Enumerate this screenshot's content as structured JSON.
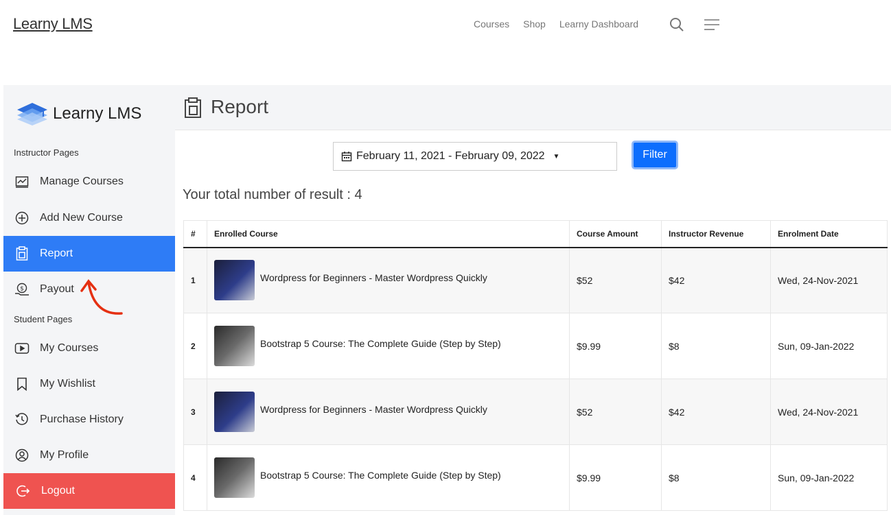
{
  "site": {
    "logo": "Learny LMS",
    "nav": [
      "Courses",
      "Shop",
      "Learny Dashboard"
    ]
  },
  "sidebar": {
    "brand": "Learny LMS",
    "instructor_heading": "Instructor Pages",
    "instructor_items": [
      {
        "label": "Manage Courses",
        "icon": "chart-icon"
      },
      {
        "label": "Add New Course",
        "icon": "plus-circle-icon"
      },
      {
        "label": "Report",
        "icon": "clipboard-icon",
        "active": true
      },
      {
        "label": "Payout",
        "icon": "money-icon"
      }
    ],
    "student_heading": "Student Pages",
    "student_items": [
      {
        "label": "My Courses",
        "icon": "play-icon"
      },
      {
        "label": "My Wishlist",
        "icon": "bookmark-icon"
      },
      {
        "label": "Purchase History",
        "icon": "history-icon"
      },
      {
        "label": "My Profile",
        "icon": "user-icon"
      }
    ],
    "logout": "Logout"
  },
  "main": {
    "title": "Report",
    "date_range": "February 11, 2021 - February 09, 2022",
    "filter_label": "Filter",
    "result_text": "Your total number of result : 4",
    "columns": [
      "#",
      "Enrolled Course",
      "Course Amount",
      "Instructor Revenue",
      "Enrolment Date"
    ],
    "rows": [
      {
        "num": "1",
        "course": "Wordpress for Beginners - Master Wordpress Quickly",
        "amount": "$52",
        "revenue": "$42",
        "date": "Wed, 24-Nov-2021",
        "thumb": "wp"
      },
      {
        "num": "2",
        "course": "Bootstrap 5 Course: The Complete Guide (Step by Step)",
        "amount": "$9.99",
        "revenue": "$8",
        "date": "Sun, 09-Jan-2022",
        "thumb": "bs"
      },
      {
        "num": "3",
        "course": "Wordpress for Beginners - Master Wordpress Quickly",
        "amount": "$52",
        "revenue": "$42",
        "date": "Wed, 24-Nov-2021",
        "thumb": "wp"
      },
      {
        "num": "4",
        "course": "Bootstrap 5 Course: The Complete Guide (Step by Step)",
        "amount": "$9.99",
        "revenue": "$8",
        "date": "Sun, 09-Jan-2022",
        "thumb": "bs"
      }
    ]
  },
  "colors": {
    "active": "#2e7cf6",
    "logout": "#ef5350",
    "filter": "#0d6efd",
    "annotation": "#e53012"
  }
}
